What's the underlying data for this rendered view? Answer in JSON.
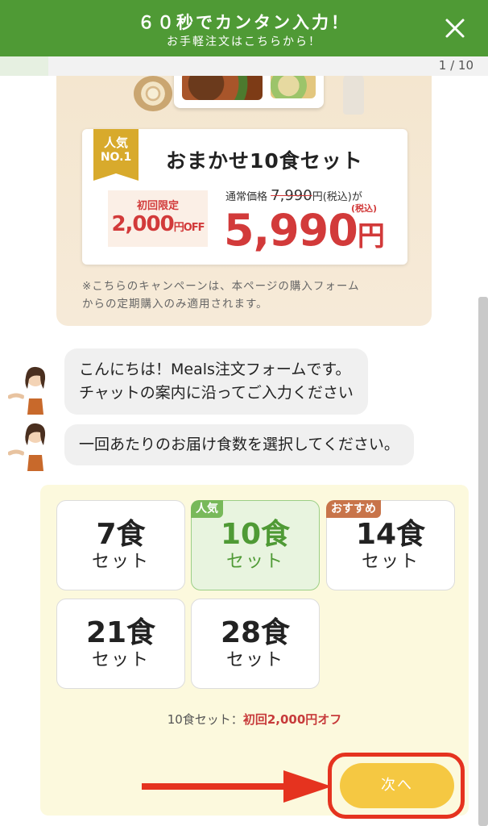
{
  "header": {
    "title": "６０秒でカンタン入力！",
    "subtitle": "お手軽注文はこちらから！"
  },
  "progress": {
    "counter": "1 / 10",
    "current": 1,
    "total": 10
  },
  "banner": {
    "ribbon_line1": "人気",
    "ribbon_line2": "NO.1",
    "set_title": "おまかせ10食セット",
    "first_label": "初回限定",
    "first_value": "2,000",
    "first_unit": "円OFF",
    "regular_label": "通常価格",
    "regular_price": "7,990",
    "regular_suffix": "円(税込)が",
    "sale_price": "5,990",
    "sale_yen": "円",
    "sale_tax": "(税込)",
    "note_line1": "※こちらのキャンペーンは、本ページの購入フォーム",
    "note_line2": "からの定期購入のみ適用されます。"
  },
  "chat": {
    "greeting_line1": "こんにちは！Meals注文フォームです。",
    "greeting_line2": "チャットの案内に沿ってご入力ください",
    "question": "一回あたりのお届け食数を選択してください。"
  },
  "options": [
    {
      "num": "7食",
      "sub": "セット",
      "tag": ""
    },
    {
      "num": "10食",
      "sub": "セット",
      "tag": "人気",
      "selected": true
    },
    {
      "num": "14食",
      "sub": "セット",
      "tag": "おすすめ"
    },
    {
      "num": "21食",
      "sub": "セット",
      "tag": ""
    },
    {
      "num": "28食",
      "sub": "セット",
      "tag": ""
    }
  ],
  "summary": {
    "label": "10食セット：",
    "highlight": "初回2,000円オフ"
  },
  "next_button": "次へ",
  "colors": {
    "header": "#4f9a35",
    "price_red": "#d23a3a",
    "button_yellow": "#f5c842",
    "highlight_frame": "#e5331f"
  }
}
